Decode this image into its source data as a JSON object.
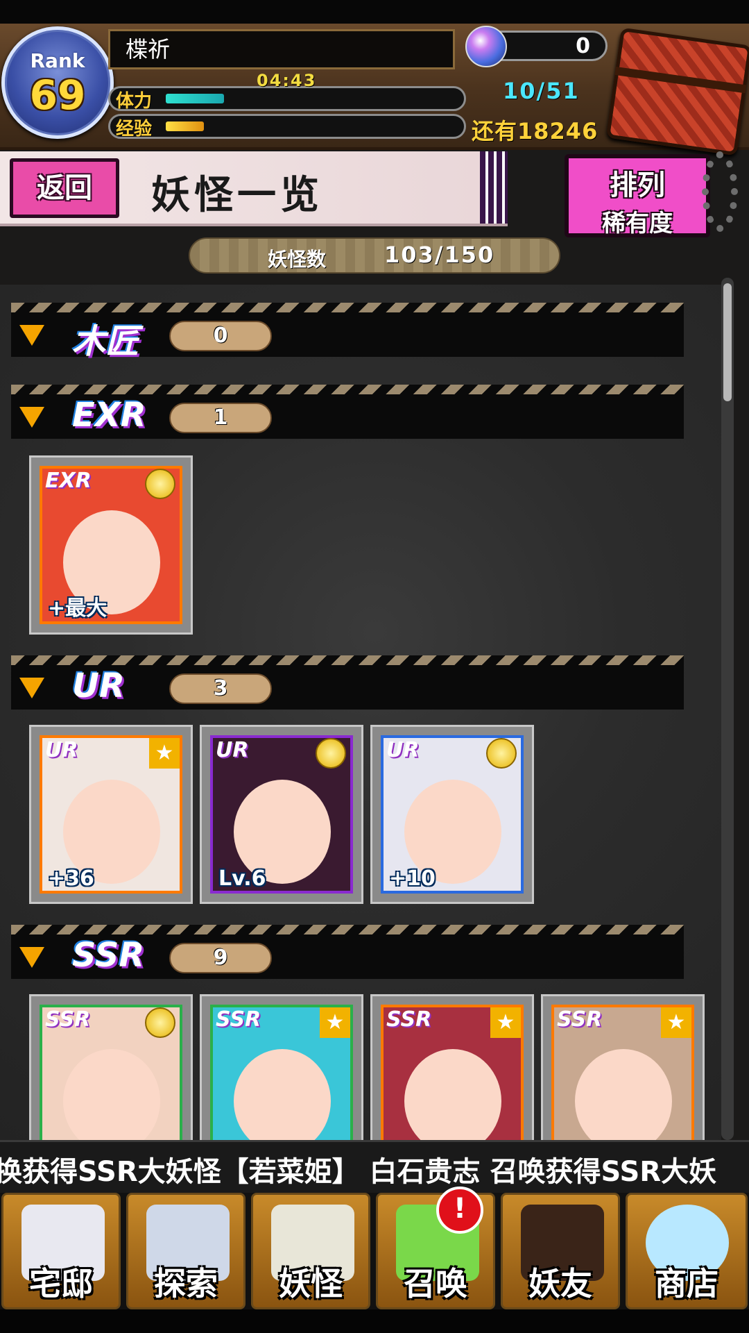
{
  "player": {
    "rank_label": "Rank",
    "rank_value": "69",
    "name": "楪祈",
    "stamina_label": "体力",
    "stamina_timer": "04:43",
    "stamina_fraction": 0.2,
    "stamina_count": "10/51",
    "exp_label": "经验",
    "exp_fraction": 0.13,
    "exp_remaining": "还有18246",
    "orb_count": "0"
  },
  "header": {
    "back_label": "返回",
    "title": "妖怪一览",
    "sort_title": "排列",
    "sort_mode": "稀有度",
    "count_label": "妖怪数",
    "count_value": "103/150"
  },
  "sections": [
    {
      "rarity": "木匠",
      "count": "0"
    },
    {
      "rarity": "EXR",
      "count": "1"
    },
    {
      "rarity": "UR",
      "count": "3"
    },
    {
      "rarity": "SSR",
      "count": "9"
    }
  ],
  "cards": {
    "exr": [
      {
        "rarity": "EXR",
        "level": "+最大",
        "badge": "medal",
        "frame": "#ff7a00",
        "bg": "#e84a30"
      }
    ],
    "ur": [
      {
        "rarity": "UR",
        "level": "+36",
        "badge": "star",
        "frame": "#ff7a00",
        "bg": "#f0e6e0"
      },
      {
        "rarity": "UR",
        "level": "Lv.6",
        "badge": "medal",
        "frame": "#8a2ad0",
        "bg": "#3a1a30"
      },
      {
        "rarity": "UR",
        "level": "+10",
        "badge": "medal",
        "frame": "#2a6ae0",
        "bg": "#e6e6f0"
      }
    ],
    "ssr": [
      {
        "rarity": "SSR",
        "badge": "medal",
        "frame": "#2ab04a",
        "bg": "#f2d2c0"
      },
      {
        "rarity": "SSR",
        "badge": "star",
        "frame": "#2ab04a",
        "bg": "#3ac6d8"
      },
      {
        "rarity": "SSR",
        "badge": "star",
        "frame": "#ff7a00",
        "bg": "#a83040"
      },
      {
        "rarity": "SSR",
        "badge": "star",
        "frame": "#ff7a00",
        "bg": "#c8a890"
      }
    ]
  },
  "ticker": "换获得SSR大妖怪【若菜姫】   白石贵志 召唤获得SSR大妖",
  "nav": [
    {
      "label": "宅邸",
      "icon": "mansion-icon",
      "color": "#e8e8f0"
    },
    {
      "label": "探索",
      "icon": "magnifier-icon",
      "color": "#cfd8e8"
    },
    {
      "label": "妖怪",
      "icon": "scroll-icon",
      "color": "#e8e6d8"
    },
    {
      "label": "召唤",
      "icon": "summon-star-icon",
      "color": "#7ad84a",
      "alert": "!"
    },
    {
      "label": "妖友",
      "icon": "friend-icon",
      "color": "#3a2418"
    },
    {
      "label": "商店",
      "icon": "crystal-orb-icon",
      "color": "#b8e8ff"
    }
  ],
  "colors": {
    "accent_pink": "#f04ec8",
    "stamina_cyan": "#4be7ff",
    "gold": "#ffd23a"
  }
}
